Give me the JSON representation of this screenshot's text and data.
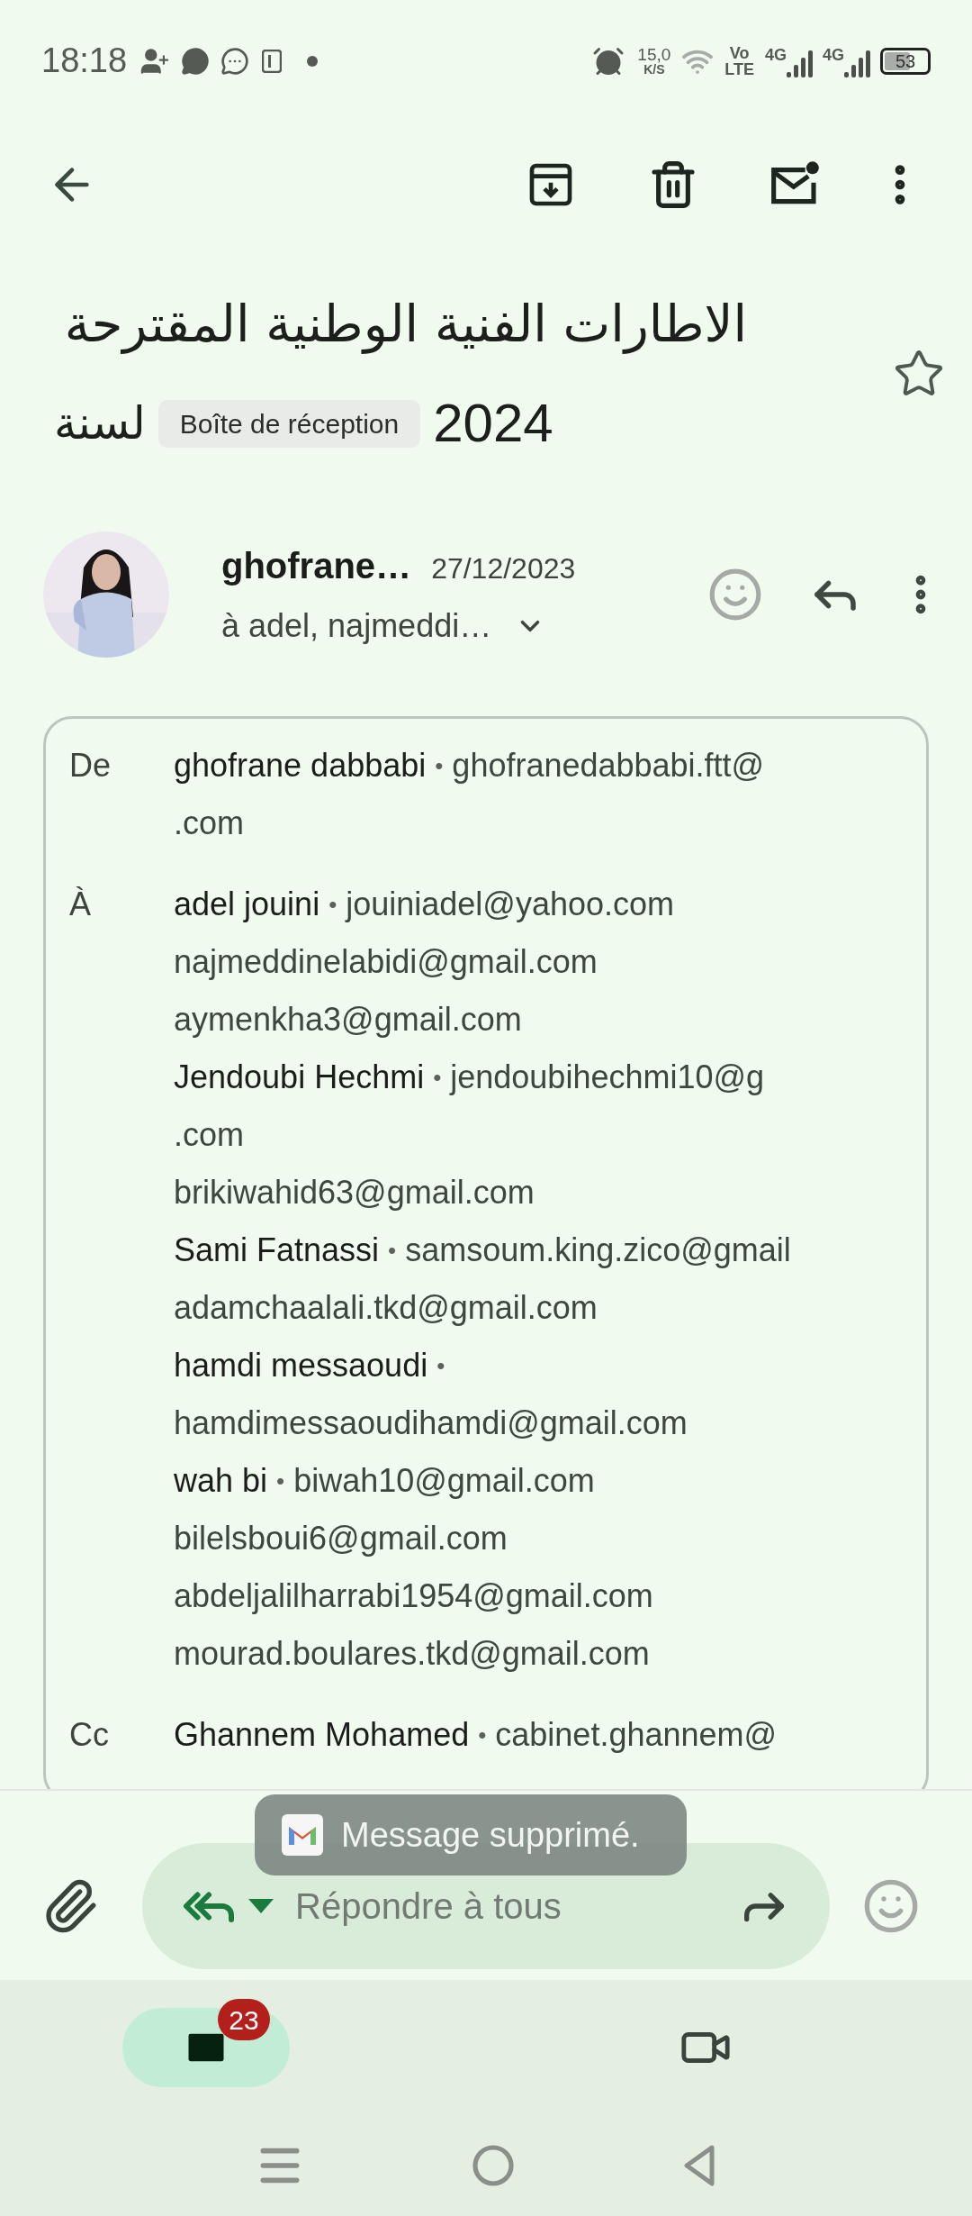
{
  "status_bar": {
    "time": "18:18",
    "speed": "15,0",
    "speed_unit": "K/S",
    "volte_top": "Vo",
    "volte_bottom": "LTE",
    "network_1": "4G",
    "network_2": "4G",
    "battery": "53"
  },
  "subject": {
    "line_1": "الاطارات الفنية الوطنية المقترحة",
    "line_2": "لسنة",
    "label": "Boîte de réception",
    "year": "2024",
    "starred": false
  },
  "message": {
    "sender": "ghofrane…",
    "date": "27/12/2023",
    "recipients": "à adel, najmeddi…",
    "details": [
      {
        "label": "De",
        "lines": [
          {
            "name": "ghofrane dabbabi",
            "separator": "•",
            "email": "ghofranedabbabi.ftt@"
          },
          {
            "email": ".com"
          }
        ]
      },
      {
        "label": "À",
        "lines": [
          {
            "name": "adel jouini",
            "separator": "•",
            "email": "jouiniadel@yahoo.com"
          },
          {
            "email": "najmeddinelabidi@gmail.com"
          },
          {
            "email": "aymenkha3@gmail.com"
          },
          {
            "name": "Jendoubi Hechmi",
            "separator": "•",
            "email": "jendoubihechmi10@g"
          },
          {
            "email": ".com"
          },
          {
            "email": "brikiwahid63@gmail.com"
          },
          {
            "name": "Sami Fatnassi",
            "separator": "•",
            "email": "samsoum.king.zico@gmail"
          },
          {
            "email": "adamchaalali.tkd@gmail.com"
          },
          {
            "name": "hamdi messaoudi",
            "separator": "•"
          },
          {
            "email": "hamdimessaoudihamdi@gmail.com"
          },
          {
            "name": "wah bi",
            "separator": "•",
            "email": "biwah10@gmail.com"
          },
          {
            "email": "bilelsboui6@gmail.com"
          },
          {
            "email": "abdeljalilharrabi1954@gmail.com"
          },
          {
            "email": "mourad.boulares.tkd@gmail.com"
          }
        ]
      },
      {
        "label": "Cc",
        "lines": [
          {
            "name": "Ghannem Mohamed",
            "separator": "•",
            "email": "cabinet.ghannem@"
          }
        ]
      }
    ]
  },
  "compose": {
    "placeholder": "Répondre à tous"
  },
  "toast": {
    "text": "Message supprimé."
  },
  "bottom_nav": {
    "tabs": [
      {
        "kind": "mail",
        "badge": "23",
        "selected": true
      },
      {
        "kind": "video",
        "selected": false
      }
    ]
  }
}
